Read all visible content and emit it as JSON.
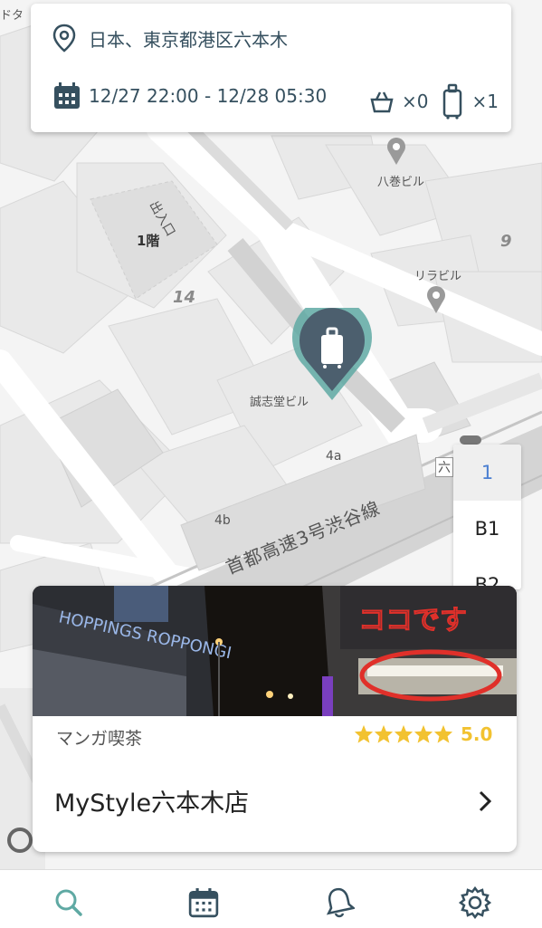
{
  "search": {
    "location": "日本、東京都港区六本木",
    "datetime": "12/27 22:00 - 12/28 05:30",
    "bag_count": "×0",
    "suitcase_count": "×1"
  },
  "map": {
    "labels": {
      "hachimaki": "八巻ビル",
      "riraburu": "リラビル",
      "seishido": "誠志堂ビル",
      "entrance": "出入口",
      "floor1": "1階",
      "block14": "14",
      "block9": "9",
      "exit4a": "4a",
      "exit4b": "4b",
      "expressway": "首都高速3号渋谷線",
      "corner_top": "ドタ",
      "roppongi_sign": "六"
    }
  },
  "floors": [
    "1",
    "B1",
    "B2"
  ],
  "shop": {
    "category": "マンガ喫茶",
    "rating": "5.0",
    "stars": 5,
    "name": "MyStyle六本木店",
    "photo_sign_left": "HOPPINGS ROPPONGI",
    "photo_handwriting": "ココです"
  },
  "colors": {
    "accent": "#5fa9a3",
    "marker": "#4c5f6e",
    "star": "#f2c230",
    "text_dark": "#36505f"
  },
  "tabs": [
    "search-icon",
    "calendar-icon",
    "bell-icon",
    "gear-icon"
  ]
}
